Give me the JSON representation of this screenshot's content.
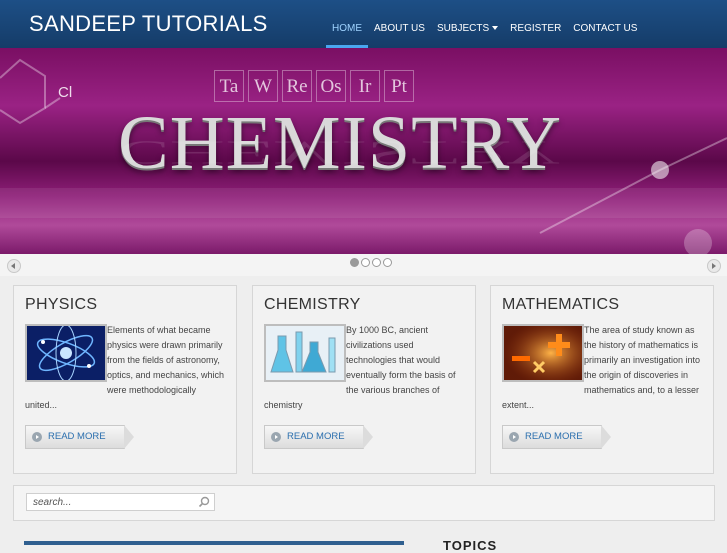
{
  "header": {
    "brand": "SANDEEP TUTORIALS",
    "nav": [
      {
        "label": "HOME",
        "active": true
      },
      {
        "label": "ABOUT US"
      },
      {
        "label": "SUBJECTS",
        "dropdown": true
      },
      {
        "label": "REGISTER"
      },
      {
        "label": "CONTACT US"
      }
    ]
  },
  "hero": {
    "title": "CHEMISTRY",
    "elements": [
      "Ta",
      "W",
      "Re",
      "Os",
      "Ir",
      "Pt"
    ],
    "chem_label": "Cl",
    "slides_count": 4,
    "active_slide": 1
  },
  "cards": [
    {
      "title": "PHYSICS",
      "text": "Elements of what became physics were drawn primarily from the fields of astronomy, optics, and mechanics, which were methodologically united...",
      "button": "READ MORE"
    },
    {
      "title": "CHEMISTRY",
      "text": "By 1000 BC, ancient civilizations used technologies that would eventually form the basis of the various branches of chemistry",
      "button": "READ MORE"
    },
    {
      "title": "MATHEMATICS",
      "text": "The area of study known as the history of mathematics is primarily an investigation into the origin of discoveries in mathematics and, to a lesser extent...",
      "button": "READ MORE"
    }
  ],
  "search": {
    "placeholder": "search..."
  },
  "topics_heading": "TOPICS",
  "colors": {
    "header_bg": "#1d4f86",
    "nav_active": "#4aa6ef",
    "hero_magenta": "#8e1e78",
    "link_blue": "#2b6fae"
  }
}
